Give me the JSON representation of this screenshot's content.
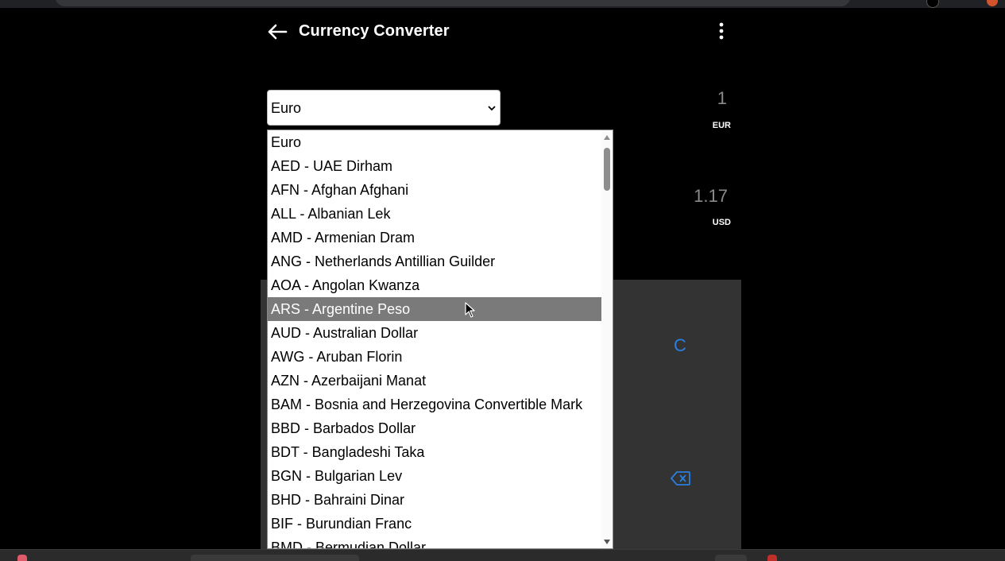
{
  "app": {
    "title": "Currency Converter"
  },
  "from_select": {
    "value": "Euro"
  },
  "from_amount": {
    "value": "1",
    "code": "EUR"
  },
  "to_amount": {
    "value": "1.17",
    "code": "USD"
  },
  "keypad": {
    "clear_label": "C"
  },
  "dropdown": {
    "options": [
      "Euro",
      "AED - UAE Dirham",
      "AFN - Afghan Afghani",
      "ALL - Albanian Lek",
      "AMD - Armenian Dram",
      "ANG - Netherlands Antillian Guilder",
      "AOA - Angolan Kwanza",
      "ARS - Argentine Peso",
      "AUD - Australian Dollar",
      "AWG - Aruban Florin",
      "AZN - Azerbaijani Manat",
      "BAM - Bosnia and Herzegovina Convertible Mark",
      "BBD - Barbados Dollar",
      "BDT - Bangladeshi Taka",
      "BGN - Bulgarian Lev",
      "BHD - Bahraini Dinar",
      "BIF - Burundian Franc",
      "BMD - Bermudian Dollar"
    ],
    "highlighted_index": 7
  },
  "colors": {
    "background": "#000000",
    "keypad": "#333333",
    "accent": "#2a7fe0",
    "highlight": "#7a7a7a",
    "muted_text": "#8a8a8a"
  },
  "icons": {
    "back": "arrow-left-icon",
    "more": "more-vertical-icon",
    "backspace": "backspace-icon",
    "dropdown": "chevron-down-icon"
  }
}
